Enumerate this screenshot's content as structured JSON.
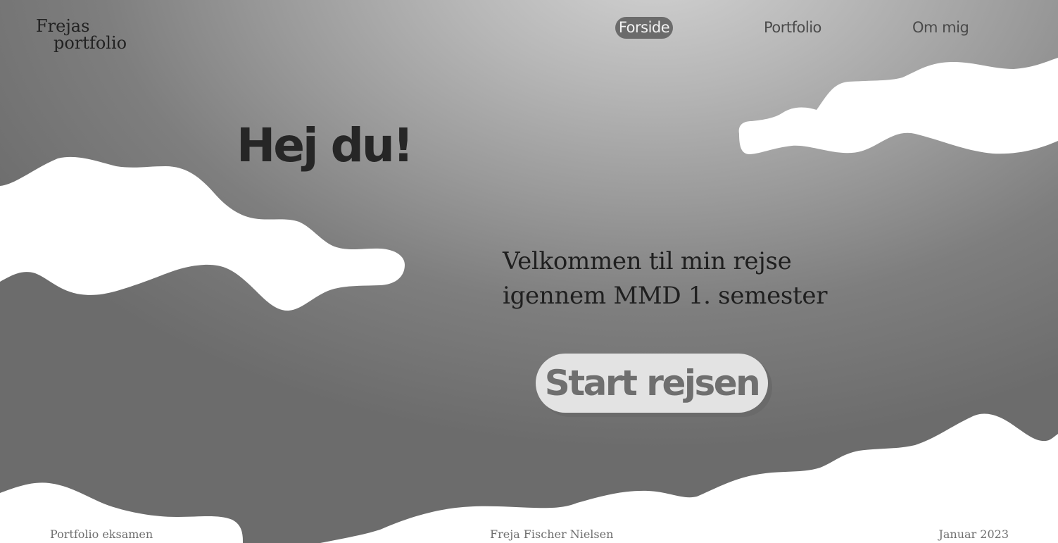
{
  "logo": {
    "line1": "Frejas",
    "line2": "portfolio"
  },
  "nav": {
    "items": [
      {
        "label": "Forside",
        "active": true
      },
      {
        "label": "Portfolio",
        "active": false
      },
      {
        "label": "Om mig",
        "active": false
      }
    ]
  },
  "hero": {
    "title": "Hej du!",
    "welcome_line1": "Velkommen til min rejse",
    "welcome_line2": "igennem MMD 1. semester",
    "cta_label": "Start rejsen"
  },
  "footer": {
    "left": "Portfolio eksamen",
    "center": "Freja Fischer Nielsen",
    "right": "Januar 2023"
  },
  "colors": {
    "background_light": "#d4d4d4",
    "background_dark": "#6c6c6c",
    "cloud": "#ffffff",
    "nav_active_bg": "#6b6b6b",
    "cta_bg": "#e3e3e3",
    "text_dark": "#262626"
  }
}
